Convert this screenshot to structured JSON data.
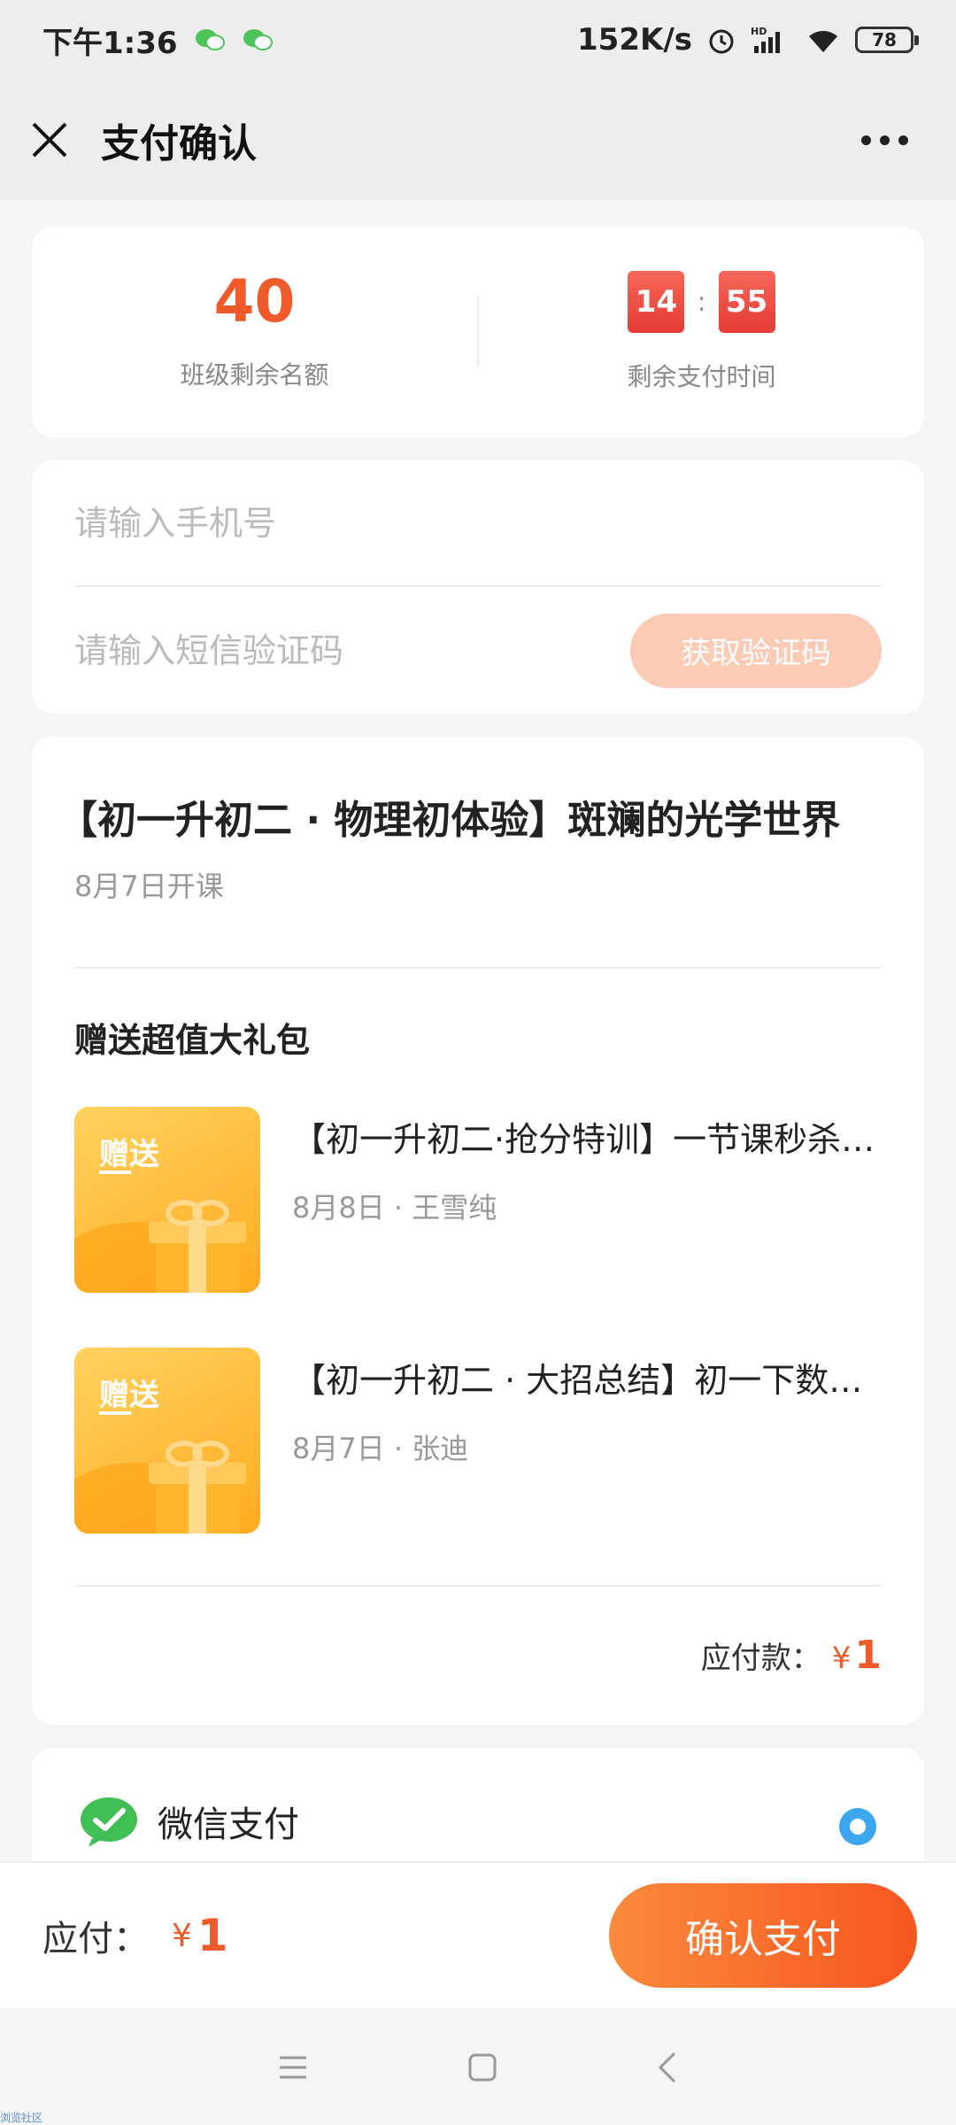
{
  "status_bar": {
    "time": "下午1:36",
    "network_speed": "152K/s",
    "signal_label": "HD",
    "battery": "78"
  },
  "nav": {
    "title": "支付确认",
    "close_icon": "close-icon",
    "more_icon": "more-dots-icon"
  },
  "stats": {
    "seats_remaining": "40",
    "seats_label": "班级剩余名额",
    "timer_minutes": "14",
    "timer_separator": ":",
    "timer_seconds": "55",
    "timer_label": "剩余支付时间"
  },
  "form": {
    "phone_placeholder": "请输入手机号",
    "code_placeholder": "请输入短信验证码",
    "get_code_label": "获取验证码"
  },
  "course": {
    "title": "【初一升初二 · 物理初体验】斑斓的光学世界",
    "start_date": "8月7日开课",
    "gift_heading": "赠送超值大礼包",
    "gift_tag": "赠送",
    "gifts": [
      {
        "name": "【初一升初二·抢分特训】一节课秒杀初一下数学压轴题",
        "meta": "8月8日 · 王雪纯"
      },
      {
        "name": "【初一升初二 · 大招总结】初一下数学几何模型",
        "meta": "8月7日 · 张迪"
      }
    ],
    "amount_label": "应付款：",
    "amount_currency": "¥",
    "amount_value": "1"
  },
  "payment": {
    "method_label": "微信支付",
    "method_icon": "wechat-pay-icon",
    "selected": true
  },
  "bottom": {
    "total_label": "应付：",
    "total_currency": "¥",
    "total_value": "1",
    "confirm_label": "确认支付"
  },
  "watermark": "浏览社区",
  "colors": {
    "accent": "#ee5a2a",
    "timer_bg": "#e8433a",
    "code_button": "#fccbb6",
    "radio": "#3ca7f0",
    "wechat_green": "#3fbf54"
  }
}
